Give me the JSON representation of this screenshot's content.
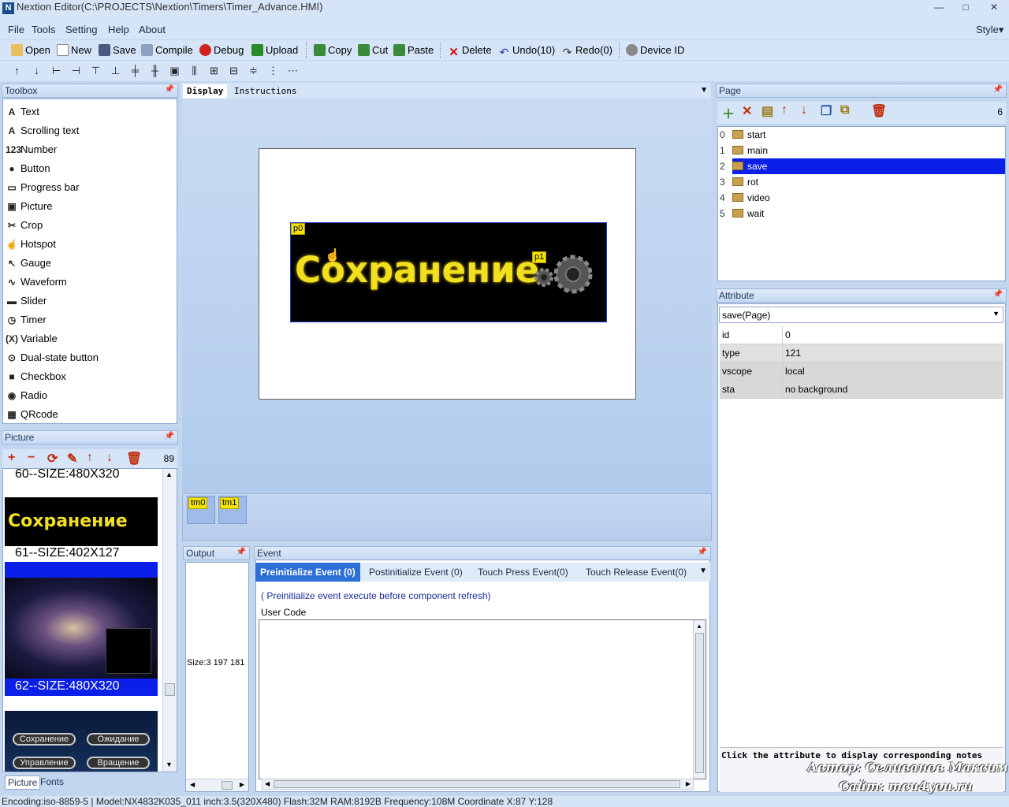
{
  "window": {
    "title": "Nextion Editor(C:\\PROJECTS\\Nextion\\Timers\\Timer_Advance.HMI)",
    "app_icon": "nextion-logo-icon",
    "min": "—",
    "max": "□",
    "close": "✕"
  },
  "menu": {
    "file": "File",
    "tools": "Tools",
    "setting": "Setting",
    "help": "Help",
    "about": "About",
    "style": "Style▾"
  },
  "toolbar": {
    "open": "Open",
    "new": "New",
    "save": "Save",
    "compile": "Compile",
    "debug": "Debug",
    "upload": "Upload",
    "copy": "Copy",
    "cut": "Cut",
    "paste": "Paste",
    "delete": "Delete",
    "undo": "Undo(10)",
    "redo": "Redo(0)",
    "device_id": "Device  ID"
  },
  "toolbox": {
    "title": "Toolbox",
    "items": [
      {
        "g": "A",
        "label": "Text"
      },
      {
        "g": "A",
        "label": "Scrolling text"
      },
      {
        "g": "123",
        "label": "Number"
      },
      {
        "g": "●",
        "label": "Button"
      },
      {
        "g": "▭",
        "label": "Progress bar"
      },
      {
        "g": "▣",
        "label": "Picture"
      },
      {
        "g": "✂",
        "label": "Crop"
      },
      {
        "g": "☝",
        "label": "Hotspot"
      },
      {
        "g": "↖",
        "label": "Gauge"
      },
      {
        "g": "∿",
        "label": "Waveform"
      },
      {
        "g": "▬",
        "label": "Slider"
      },
      {
        "g": "◷",
        "label": "Timer"
      },
      {
        "g": "(X)",
        "label": "Variable"
      },
      {
        "g": "⊙",
        "label": "Dual-state button"
      },
      {
        "g": "■",
        "label": "Checkbox"
      },
      {
        "g": "◉",
        "label": "Radio"
      },
      {
        "g": "▦",
        "label": "QRcode"
      }
    ]
  },
  "picture": {
    "title": "Picture",
    "count": "89",
    "items": [
      "60--SIZE:480X320",
      "61--SIZE:402X127",
      "62--SIZE:480X320"
    ],
    "thumb_text": "Сохранение",
    "buttons": [
      "Сохранение",
      "Ожидание",
      "Управление",
      "Вращение"
    ],
    "tab_picture": "Picture",
    "tab_fonts": "Fonts"
  },
  "doc": {
    "tab_display": "Display",
    "tab_instructions": "Instructions",
    "banner_text": "Сохранение",
    "tag_p0": "p0",
    "tag_p1": "p1",
    "timers": [
      "tm0",
      "tm1"
    ]
  },
  "output": {
    "title": "Output",
    "size": "Size:3 197 181"
  },
  "event": {
    "title": "Event",
    "tabs": [
      "Preinitialize Event (0)",
      "Postinitialize Event (0)",
      "Touch Press Event(0)",
      "Touch Release Event(0)"
    ],
    "note": "( Preinitialize event execute before component refresh)",
    "user_code": "User Code"
  },
  "page": {
    "title": "Page",
    "count": "6",
    "items": [
      {
        "n": "0",
        "name": "start"
      },
      {
        "n": "1",
        "name": "main"
      },
      {
        "n": "2",
        "name": "save"
      },
      {
        "n": "3",
        "name": "rot"
      },
      {
        "n": "4",
        "name": "video"
      },
      {
        "n": "5",
        "name": "wait"
      }
    ],
    "selected": 2
  },
  "attribute": {
    "title": "Attribute",
    "selector": "save(Page)",
    "rows": [
      {
        "k": "id",
        "v": "0"
      },
      {
        "k": "type",
        "v": "121"
      },
      {
        "k": "vscope",
        "v": "local"
      },
      {
        "k": "sta",
        "v": "no background"
      }
    ],
    "note": "Click the attribute to display corresponding notes"
  },
  "watermark": {
    "author": "Автор: Селиванов Максим",
    "site": "Сайт: mcu4you.ru"
  },
  "status": "Encoding:iso-8859-5 | Model:NX4832K035_011  inch:3.5(320X480) Flash:32M RAM:8192B Frequency:108M    Coordinate X:87  Y:128",
  "colors": {
    "accent": "#0a1fe8",
    "banner_text": "#f0e020",
    "tag": "#f4e400"
  }
}
